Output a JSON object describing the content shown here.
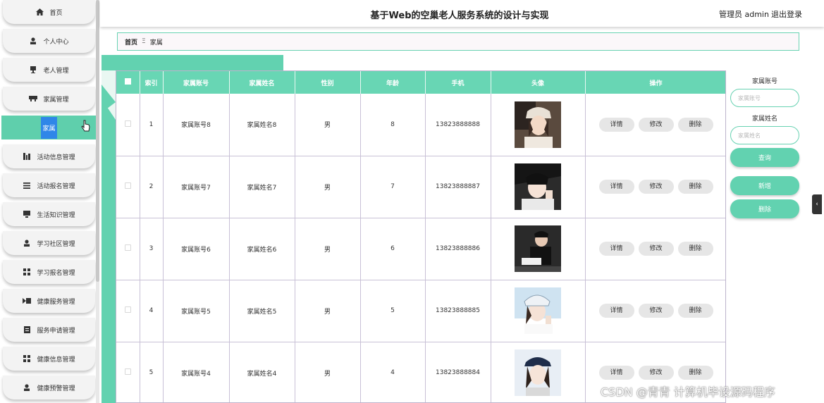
{
  "header": {
    "title": "基于Web的空巢老人服务系统的设计与实现",
    "admin": "管理员 admin",
    "logout": "退出登录"
  },
  "sidebar": {
    "items": [
      {
        "label": "首页",
        "icon": "home-icon"
      },
      {
        "label": "个人中心",
        "icon": "person-icon"
      },
      {
        "label": "老人管理",
        "icon": "elder-icon"
      },
      {
        "label": "家属管理",
        "icon": "family-icon"
      },
      {
        "label": "活动信息管理",
        "icon": "activity-icon"
      },
      {
        "label": "活动报名管理",
        "icon": "list-icon"
      },
      {
        "label": "生活知识管理",
        "icon": "monitor-icon"
      },
      {
        "label": "学习社区管理",
        "icon": "person-icon"
      },
      {
        "label": "学习报名管理",
        "icon": "grid-icon"
      },
      {
        "label": "健康服务管理",
        "icon": "service-icon"
      },
      {
        "label": "服务申请管理",
        "icon": "doc-icon"
      },
      {
        "label": "健康信息管理",
        "icon": "grid-icon"
      },
      {
        "label": "健康预警管理",
        "icon": "person-icon"
      }
    ],
    "sub_item": "家属"
  },
  "breadcrumb": {
    "home": "首页",
    "sep": "Ξ",
    "current": "家属"
  },
  "table": {
    "headers": [
      "",
      "索引",
      "家属账号",
      "家属姓名",
      "性别",
      "年龄",
      "手机",
      "头像",
      "操作"
    ],
    "actions": {
      "detail": "详情",
      "edit": "修改",
      "delete": "删除"
    },
    "rows": [
      {
        "index": "1",
        "account": "家属账号8",
        "name": "家属姓名8",
        "gender": "男",
        "age": "8",
        "phone": "13823888888"
      },
      {
        "index": "2",
        "account": "家属账号7",
        "name": "家属姓名7",
        "gender": "男",
        "age": "7",
        "phone": "13823888887"
      },
      {
        "index": "3",
        "account": "家属账号6",
        "name": "家属姓名6",
        "gender": "男",
        "age": "6",
        "phone": "13823888886"
      },
      {
        "index": "4",
        "account": "家属账号5",
        "name": "家属姓名5",
        "gender": "男",
        "age": "5",
        "phone": "13823888885"
      },
      {
        "index": "5",
        "account": "家属账号4",
        "name": "家属姓名4",
        "gender": "男",
        "age": "4",
        "phone": "13823888884"
      }
    ]
  },
  "search": {
    "account_label": "家属账号",
    "account_placeholder": "家属账号",
    "name_label": "家属姓名",
    "name_placeholder": "家属姓名",
    "query_btn": "查询",
    "add_btn": "新增",
    "delete_btn": "删除"
  },
  "edge_tab": "‹",
  "watermark": "CSDN @青青  计算机毕设源码程序",
  "colors": {
    "accent": "#62d2b0",
    "header_teal": "#68d6b4",
    "highlight_blue": "#2f86e8"
  }
}
